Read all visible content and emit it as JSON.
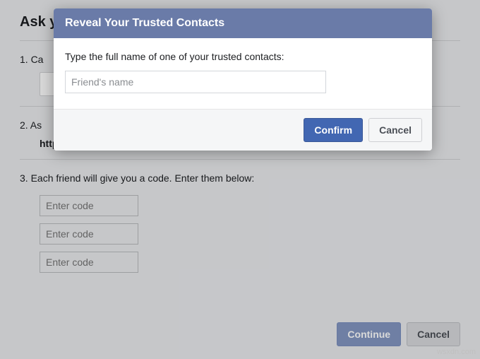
{
  "page": {
    "title_truncated": "Ask y",
    "step1_prefix": "1. Ca",
    "step2_prefix": "2. As",
    "recover_url": "https://www.facebook.com/recover",
    "step3_text": "3. Each friend will give you a code. Enter them below:",
    "code_placeholder": "Enter code",
    "continue_label": "Continue",
    "cancel_label": "Cancel"
  },
  "modal": {
    "title": "Reveal Your Trusted Contacts",
    "prompt": "Type the full name of one of your trusted contacts:",
    "input_placeholder": "Friend's name",
    "input_value": "",
    "confirm_label": "Confirm",
    "cancel_label": "Cancel"
  },
  "watermark": "wsxdn.com"
}
